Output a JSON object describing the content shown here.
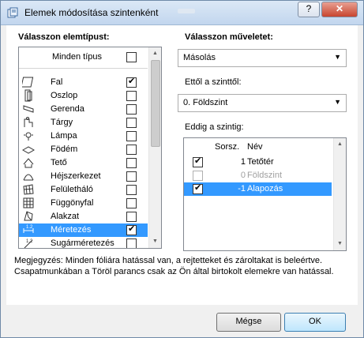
{
  "window": {
    "title": "Elemek módosítása szintenként",
    "help_label": "?",
    "close_label": "✕"
  },
  "left": {
    "header": "Válasszon elemtípust:",
    "all_types_label": "Minden típus",
    "all_types_checked": false,
    "types": [
      {
        "label": "Fal",
        "icon": "wall-icon",
        "checked": true,
        "selected": false
      },
      {
        "label": "Oszlop",
        "icon": "column-icon",
        "checked": false,
        "selected": false
      },
      {
        "label": "Gerenda",
        "icon": "beam-icon",
        "checked": false,
        "selected": false
      },
      {
        "label": "Tárgy",
        "icon": "object-icon",
        "checked": false,
        "selected": false
      },
      {
        "label": "Lámpa",
        "icon": "lamp-icon",
        "checked": false,
        "selected": false
      },
      {
        "label": "Födém",
        "icon": "slab-icon",
        "checked": false,
        "selected": false
      },
      {
        "label": "Tető",
        "icon": "roof-icon",
        "checked": false,
        "selected": false
      },
      {
        "label": "Héjszerkezet",
        "icon": "shell-icon",
        "checked": false,
        "selected": false
      },
      {
        "label": "Felületháló",
        "icon": "mesh-icon",
        "checked": false,
        "selected": false
      },
      {
        "label": "Függönyfal",
        "icon": "curtain-wall-icon",
        "checked": false,
        "selected": false
      },
      {
        "label": "Alakzat",
        "icon": "morph-icon",
        "checked": false,
        "selected": false
      },
      {
        "label": "Méretezés",
        "icon": "dimension-icon",
        "checked": true,
        "selected": true
      },
      {
        "label": "Sugárméretezés",
        "icon": "radial-dimension-icon",
        "checked": false,
        "selected": false
      }
    ]
  },
  "right": {
    "operation_header": "Válasszon műveletet:",
    "operation_value": "Másolás",
    "from_header": "Ettől a szinttől:",
    "from_value": "0. Földszint",
    "to_header": "Eddig a szintig:",
    "col_num": "Sorsz.",
    "col_name": "Név",
    "levels": [
      {
        "num": "1",
        "name": "Tetőtér",
        "checked": true,
        "disabled": false,
        "selected": false
      },
      {
        "num": "0",
        "name": "Földszint",
        "checked": false,
        "disabled": true,
        "selected": false
      },
      {
        "num": "-1",
        "name": "Alapozás",
        "checked": true,
        "disabled": false,
        "selected": true
      }
    ]
  },
  "note": "Megjegyzés: Minden fóliára hatással van, a rejtetteket és zároltakat is beleértve. Csapatmunkában a Töröl parancs csak az Ön által birtokolt elemekre van hatással.",
  "buttons": {
    "cancel": "Mégse",
    "ok": "OK"
  },
  "colors": {
    "selection": "#3399ff",
    "titlebar": "#c2d6ee",
    "ok_button": "#bee6fd"
  }
}
